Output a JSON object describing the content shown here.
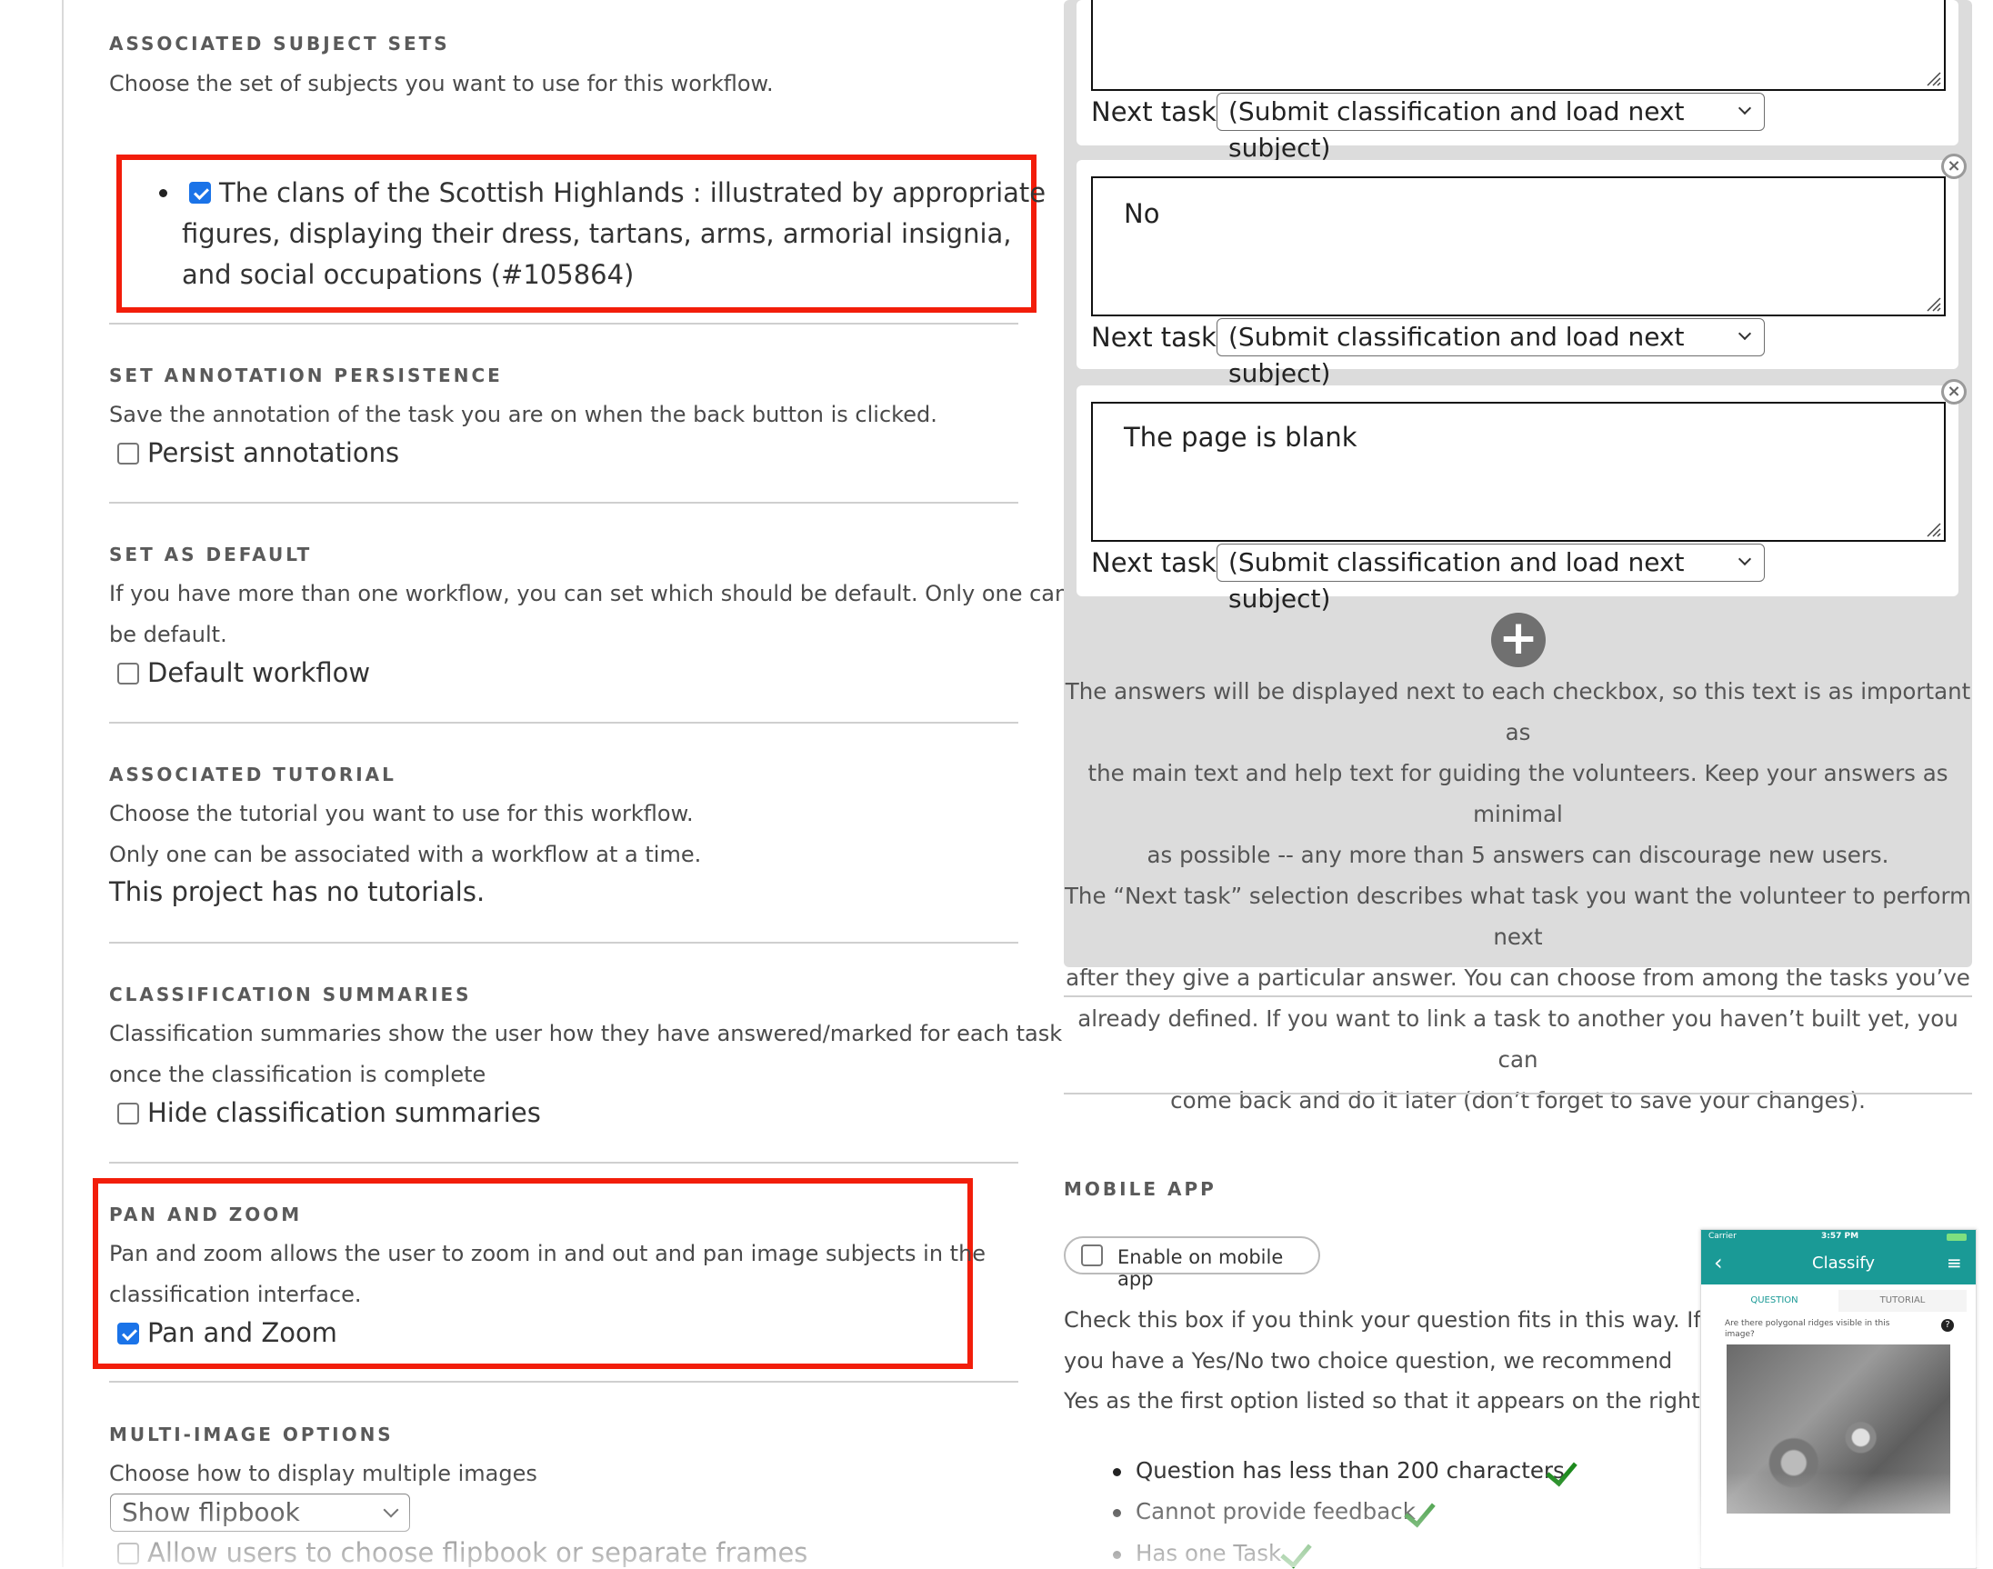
{
  "subject_sets": {
    "heading": "ASSOCIATED SUBJECT SETS",
    "description": "Choose the set of subjects you want to use for this workflow.",
    "item_line1": "The clans of the Scottish Highlands : illustrated by appropriate",
    "item_line2": "figures, displaying their dress, tartans, arms, armorial insignia,",
    "item_line3": "and social occupations (#105864)"
  },
  "persistence": {
    "heading": "SET ANNOTATION PERSISTENCE",
    "description": "Save the annotation of the task you are on when the back button is clicked.",
    "checkbox_label": "Persist annotations"
  },
  "default": {
    "heading": "SET AS DEFAULT",
    "description_line1": "If you have more than one workflow, you can set which should be default. Only one can",
    "description_line2": "be default.",
    "checkbox_label": "Default workflow"
  },
  "tutorial": {
    "heading": "ASSOCIATED TUTORIAL",
    "description_line1": "Choose the tutorial you want to use for this workflow.",
    "description_line2": "Only one can be associated with a workflow at a time.",
    "no_tutorials": "This project has no tutorials."
  },
  "summaries": {
    "heading": "CLASSIFICATION SUMMARIES",
    "description_line1": "Classification summaries show the user how they have answered/marked for each task",
    "description_line2": "once the classification is complete",
    "checkbox_label": "Hide classification summaries"
  },
  "pan_zoom": {
    "heading": "PAN AND ZOOM",
    "description_line1": "Pan and zoom allows the user to zoom in and out and pan image subjects in the",
    "description_line2": "classification interface.",
    "checkbox_label": "Pan and Zoom"
  },
  "multi_image": {
    "heading": "MULTI-IMAGE OPTIONS",
    "description": "Choose how to display multiple images",
    "select_value": "Show flipbook",
    "checkbox_label": "Allow users to choose flipbook or separate frames"
  },
  "answers": {
    "next_task_label": "Next task",
    "next_task_value": "(Submit classification and load next subject)",
    "answer_2": "No",
    "answer_3": "The page is blank",
    "help_lines": [
      "The answers will be displayed next to each checkbox, so this text is as important as",
      "the main text and help text for guiding the volunteers. Keep your answers as minimal",
      "as possible -- any more than 5 answers can discourage new users.",
      "The “Next task” selection describes what task you want the volunteer to perform next",
      "after they give a particular answer. You can choose from among the tasks you’ve",
      "already defined. If you want to link a task to another you haven’t built yet, you can",
      "come back and do it later (don’t forget to save your changes)."
    ]
  },
  "mobile": {
    "heading": "MOBILE APP",
    "checkbox_label": "Enable on mobile app",
    "desc_lines": [
      "Check this box if you think your question fits in this way. If",
      "you have a Yes/No two choice question, we recommend",
      "Yes as the first option listed so that it appears on the right."
    ],
    "criteria": [
      "Question has less than 200 characters",
      "Cannot provide feedback",
      "Has one Task"
    ],
    "phone": {
      "carrier": "Carrier",
      "time": "3:57 PM",
      "title": "Classify",
      "tab_question": "QUESTION",
      "tab_tutorial": "TUTORIAL",
      "question_line1": "Are there polygonal ridges visible in this",
      "question_line2": "image?"
    }
  },
  "colors": {
    "highlight": "#f21d0a",
    "checkbox_checked": "#1a73e8",
    "check_ok": "#1e8a1e",
    "phone_bar": "#1a9a96"
  }
}
